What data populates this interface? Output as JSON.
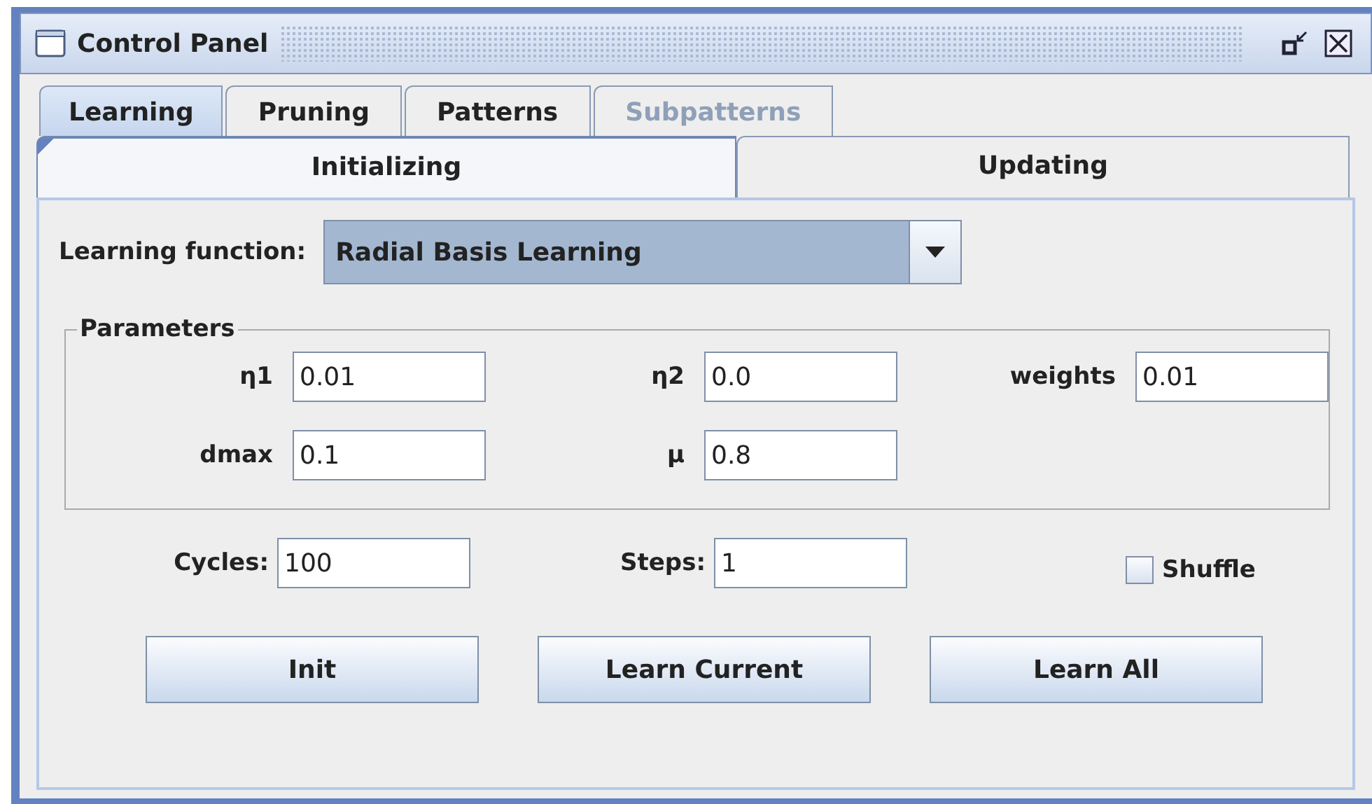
{
  "window": {
    "title": "Control Panel"
  },
  "tabs": [
    {
      "label": "Learning",
      "selected": true,
      "disabled": false
    },
    {
      "label": "Pruning",
      "selected": false,
      "disabled": false
    },
    {
      "label": "Patterns",
      "selected": false,
      "disabled": false
    },
    {
      "label": "Subpatterns",
      "selected": false,
      "disabled": true
    }
  ],
  "subtabs": [
    {
      "label": "Initializing",
      "selected": true
    },
    {
      "label": "Updating",
      "selected": false
    }
  ],
  "learning_function": {
    "label": "Learning function:",
    "value": "Radial Basis Learning"
  },
  "parameters": {
    "title": "Parameters",
    "fields": [
      {
        "label": "η1",
        "value": "0.01"
      },
      {
        "label": "η2",
        "value": "0.0"
      },
      {
        "label": "weights",
        "value": "0.01"
      },
      {
        "label": "dmax",
        "value": "0.1"
      },
      {
        "label": "μ",
        "value": "0.8"
      }
    ]
  },
  "cycles": {
    "label": "Cycles:",
    "value": "100"
  },
  "steps": {
    "label": "Steps:",
    "value": "1"
  },
  "shuffle": {
    "label": "Shuffle",
    "checked": false
  },
  "buttons": [
    "Init",
    "Learn Current",
    "Learn All"
  ]
}
